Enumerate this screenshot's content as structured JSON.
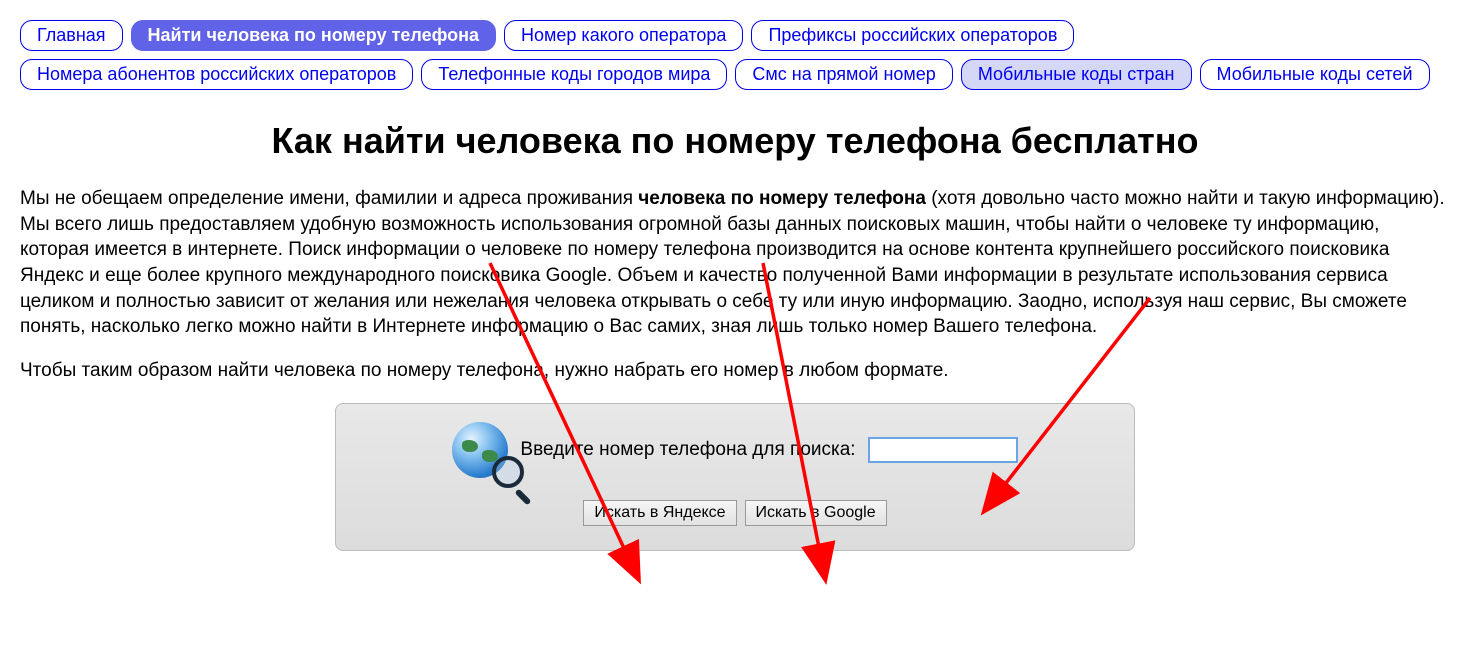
{
  "nav": {
    "items": [
      {
        "label": "Главная",
        "state": ""
      },
      {
        "label": "Найти человека по номеру телефона",
        "state": "active"
      },
      {
        "label": "Номер какого оператора",
        "state": ""
      },
      {
        "label": "Префиксы российских операторов",
        "state": ""
      },
      {
        "label": "Номера абонентов российских операторов",
        "state": ""
      },
      {
        "label": "Телефонные коды городов мира",
        "state": ""
      },
      {
        "label": "Смс на прямой номер",
        "state": ""
      },
      {
        "label": "Мобильные коды стран",
        "state": "secondary"
      },
      {
        "label": "Мобильные коды сетей",
        "state": ""
      }
    ]
  },
  "heading": "Как найти человека по номеру телефона бесплатно",
  "intro": {
    "pre": "Мы не обещаем определение имени, фамилии и адреса проживания ",
    "bold": "человека по номеру телефона",
    "post": " (хотя довольно часто можно найти и такую информацию). Мы всего лишь предоставляем удобную возможность использования огромной базы данных поисковых машин, чтобы найти о человеке ту информацию, которая имеется в интернете. Поиск информации о человеке по номеру телефона производится на основе контента крупнейшего российского поисковика Яндекс и еще более крупного международного поисковика Google. Объем и качество полученной Вами информации в результате использования сервиса целиком и полностью зависит от желания или нежелания человека открывать о себе ту или иную информацию. Заодно, используя наш сервис, Вы сможете понять, насколько легко можно найти в Интернете информацию о Вас самих, зная лишь только номер Вашего телефона."
  },
  "instruction": "Чтобы таким образом найти человека по номеру телефона, нужно набрать его номер в любом формате.",
  "search": {
    "label": "Введите номер телефона для поиска:",
    "value": "",
    "yandex": "Искать в Яндексе",
    "google": "Искать в Google"
  }
}
